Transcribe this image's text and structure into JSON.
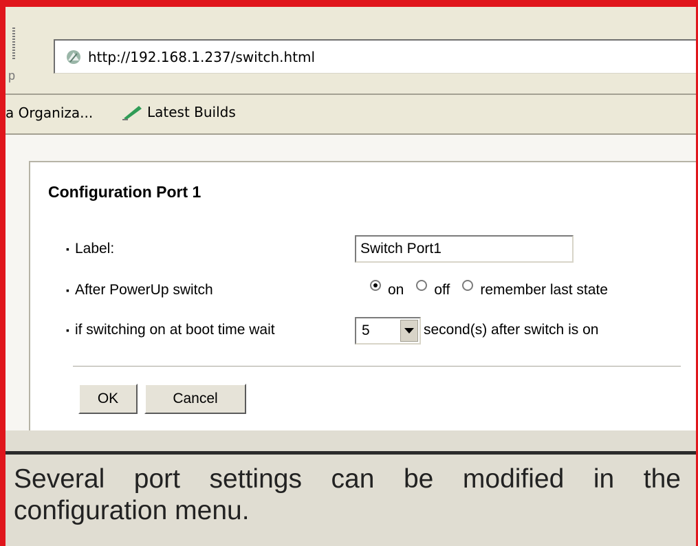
{
  "browser": {
    "left_edge_text": "p",
    "address": "http://192.168.1.237/switch.html",
    "links": [
      {
        "label": "a Organiza..."
      },
      {
        "label": "Latest Builds",
        "icon": "pen-icon"
      }
    ]
  },
  "config": {
    "title": "Configuration Port 1",
    "label_row": {
      "label": "Label:",
      "value": "Switch Port1"
    },
    "power_row": {
      "label": "After PowerUp switch",
      "options": [
        {
          "label": "on",
          "checked": true
        },
        {
          "label": "off",
          "checked": false
        },
        {
          "label": "remember last state",
          "checked": false
        }
      ]
    },
    "wait_row": {
      "label": "if switching on at boot time wait",
      "selected": "5",
      "suffix": "second(s) after switch is on"
    },
    "ok_label": "OK",
    "cancel_label": "Cancel"
  },
  "caption": {
    "line1": "Several port settings can be modified in the",
    "line2": "configuration menu."
  },
  "colors": {
    "frame_border": "#e0161c",
    "background": "#e0ddd2"
  }
}
